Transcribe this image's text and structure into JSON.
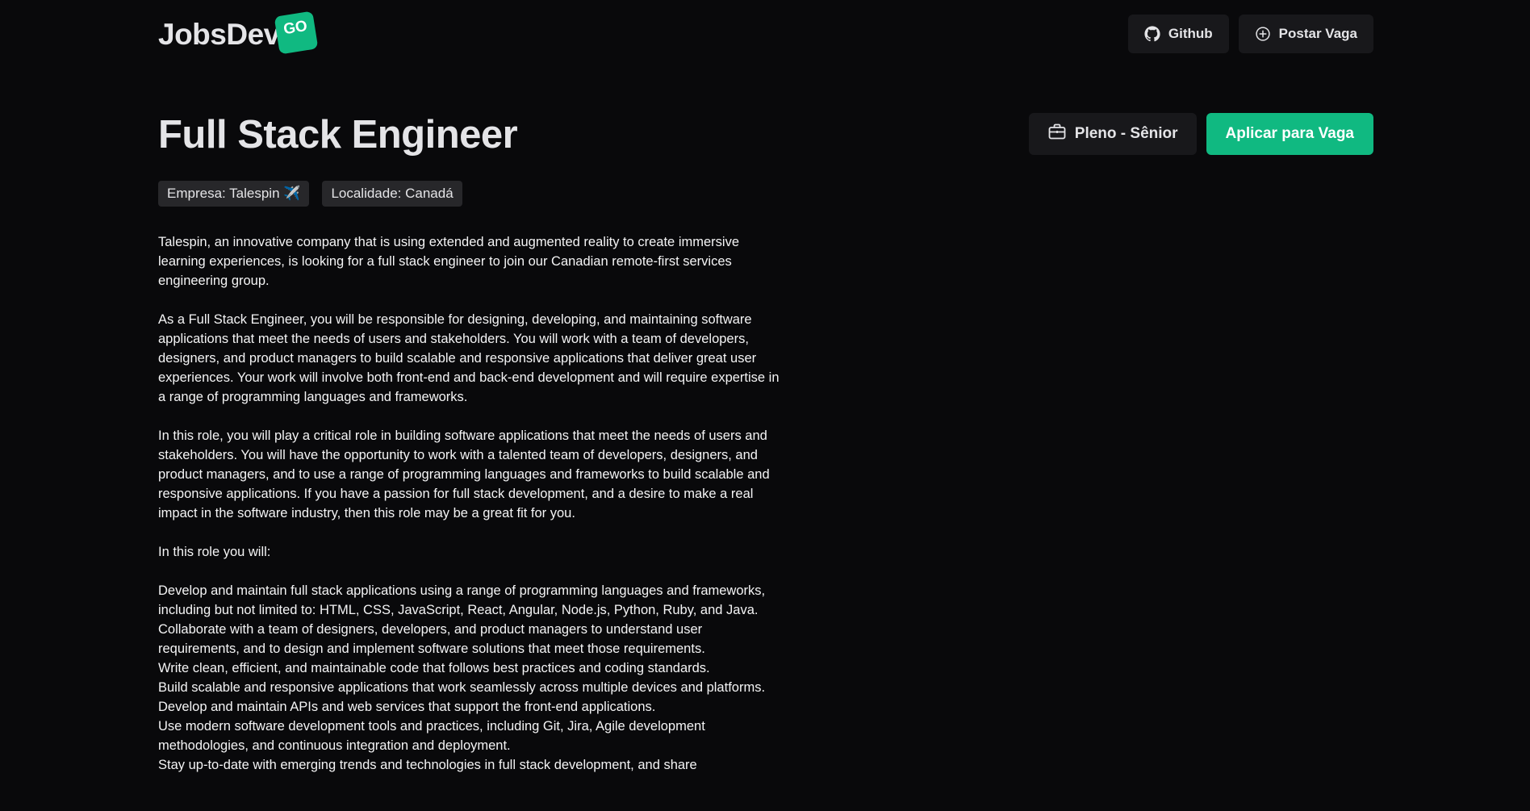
{
  "header": {
    "logo_text": "JobsDev",
    "logo_badge": "GO",
    "github_label": "Github",
    "post_job_label": "Postar Vaga"
  },
  "job": {
    "title": "Full Stack Engineer",
    "level": "Pleno - Sênior",
    "apply_label": "Aplicar para Vaga",
    "company_tag": "Empresa: Talespin ✈️",
    "location_tag": "Localidade: Canadá"
  },
  "description": {
    "intro": "Talespin, an innovative company that is using extended and augmented reality to create immersive learning experiences, is looking for a full stack engineer to join our Canadian remote-first services engineering group.",
    "role": "As a Full Stack Engineer, you will be responsible for designing, developing, and maintaining software applications that meet the needs of users and stakeholders. You will work with a team of developers, designers, and product managers to build scalable and responsive applications that deliver great user experiences. Your work will involve both front-end and back-end development and will require expertise in a range of programming languages and frameworks.",
    "impact": "In this role, you will play a critical role in building software applications that meet the needs of users and stakeholders. You will have the opportunity to work with a talented team of developers, designers, and product managers, and to use a range of programming languages and frameworks to build scalable and responsive applications. If you have a passion for full stack development, and a desire to make a real impact in the software industry, then this role may be a great fit for you.",
    "list_heading": "In this role you will:",
    "items": [
      "Develop and maintain full stack applications using a range of programming languages and frameworks, including but not limited to: HTML, CSS, JavaScript, React, Angular, Node.js, Python, Ruby, and Java.",
      "Collaborate with a team of designers, developers, and product managers to understand user requirements, and to design and implement software solutions that meet those requirements.",
      "Write clean, efficient, and maintainable code that follows best practices and coding standards.",
      "Build scalable and responsive applications that work seamlessly across multiple devices and platforms.",
      "Develop and maintain APIs and web services that support the front-end applications.",
      "Use modern software development tools and practices, including Git, Jira, Agile development methodologies, and continuous integration and deployment.",
      "Stay up-to-date with emerging trends and technologies in full stack development, and share"
    ]
  },
  "colors": {
    "background": "#09090b",
    "accent": "#10b981",
    "surface": "#18181b",
    "tag": "#27272a"
  }
}
